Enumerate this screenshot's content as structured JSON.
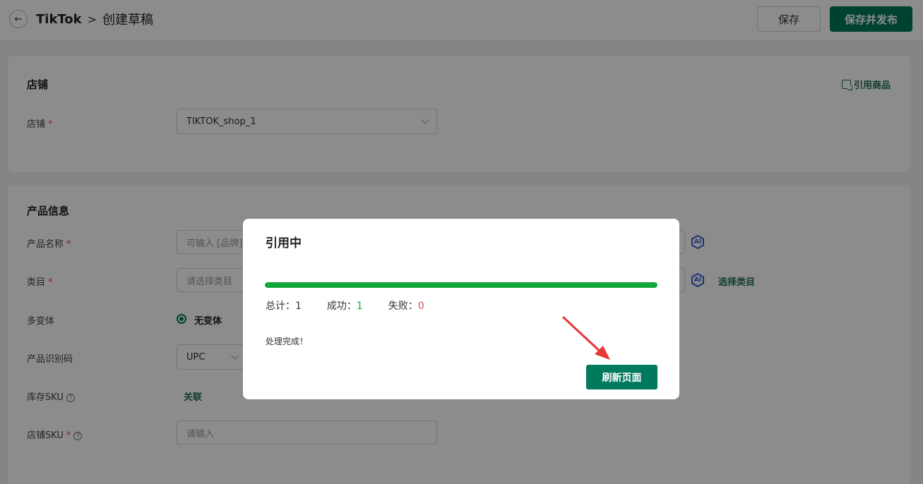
{
  "header": {
    "breadcrumb_root": "TikTok",
    "breadcrumb_sep": ">",
    "breadcrumb_current": "创建草稿",
    "save_label": "保存",
    "publish_label": "保存并发布"
  },
  "store_card": {
    "title": "店铺",
    "cite_link": "引用商品",
    "store_label": "店铺",
    "store_value": "TIKTOK_shop_1"
  },
  "product_card": {
    "title": "产品信息",
    "name_label": "产品名称",
    "name_placeholder": "可输入 [品牌]",
    "category_label": "类目",
    "category_placeholder": "请选择类目",
    "select_category": "选择类目",
    "variant_label": "多变体",
    "variant_option": "无变体",
    "identifier_label": "产品识别码",
    "identifier_value": "UPC",
    "stock_sku_label": "库存SKU",
    "stock_sku_link": "关联",
    "shop_sku_label": "店铺SKU",
    "shop_sku_placeholder": "请输入",
    "ai_badge": "AI",
    "required_mark": "*",
    "help_mark": "?"
  },
  "modal": {
    "title": "引用中",
    "progress_percent": 100,
    "total_label": "总计：",
    "total_value": "1",
    "success_label": "成功：",
    "success_value": "1",
    "fail_label": "失败：",
    "fail_value": "0",
    "message": "处理完成！",
    "refresh_label": "刷新页面"
  },
  "colors": {
    "primary": "#00795c",
    "success": "#12a839",
    "danger": "#e34d4d"
  }
}
